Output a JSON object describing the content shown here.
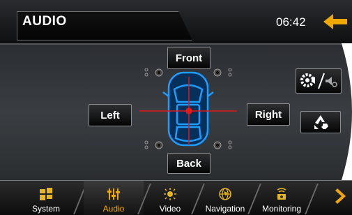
{
  "header": {
    "title": "AUDIO",
    "time": "06:42",
    "back_icon": "back-arrow-icon"
  },
  "fader": {
    "front_label": "Front",
    "back_label": "Back",
    "left_label": "Left",
    "right_label": "Right"
  },
  "side_buttons": [
    {
      "name": "settings-mute-icon"
    },
    {
      "name": "recycle-icon"
    }
  ],
  "bottom_tabs": [
    {
      "label": "System",
      "icon": "system-icon",
      "active": false
    },
    {
      "label": "Audio",
      "icon": "equalizer-icon",
      "active": true
    },
    {
      "label": "Video",
      "icon": "sun-icon",
      "active": false
    },
    {
      "label": "Navigation",
      "icon": "globe-icon",
      "active": false
    },
    {
      "label": "Monitoring",
      "icon": "camera-icon",
      "active": false
    }
  ],
  "colors": {
    "accent": "#f0a800",
    "car_blue": "#1e9cff",
    "crosshair": "#e01818"
  }
}
